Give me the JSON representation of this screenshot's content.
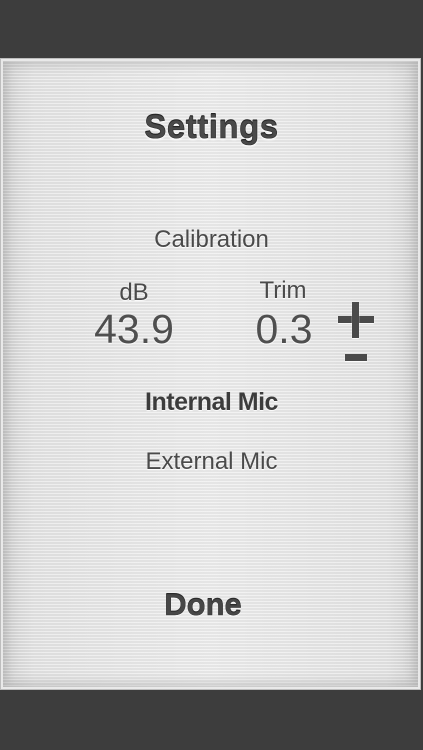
{
  "settings": {
    "title": "Settings",
    "calibration_label": "Calibration",
    "db": {
      "label": "dB",
      "value": "43.9"
    },
    "trim": {
      "label": "Trim",
      "value": "0.3"
    },
    "controls": {
      "increment_icon": "plus-icon",
      "decrement_icon": "minus-icon"
    },
    "mic_options": {
      "internal": "Internal Mic",
      "external": "External Mic",
      "selected": "Internal Mic"
    },
    "done_label": "Done"
  },
  "colors": {
    "background": "#3d3d3d",
    "panel": "#e8e8e8",
    "text": "#4a4a4a"
  }
}
